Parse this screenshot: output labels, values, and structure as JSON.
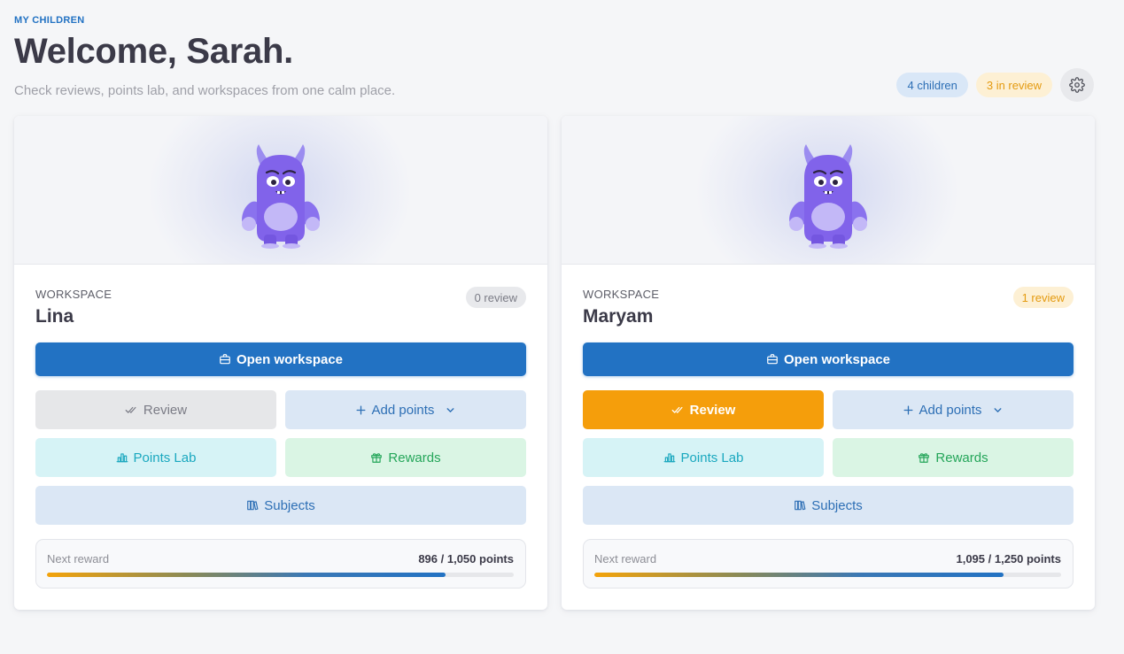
{
  "header": {
    "eyebrow": "MY CHILDREN",
    "title": "Welcome, Sarah.",
    "subtitle": "Check reviews, points lab, and workspaces from one calm place.",
    "children_chip": "4 children",
    "review_chip": "3 in review",
    "settings_icon": "gear-icon"
  },
  "colors": {
    "primary": "#2272c3",
    "review_active": "#f59e0b",
    "points_lab": "#1aa8bf",
    "rewards": "#25a65a"
  },
  "cards": [
    {
      "section_label": "WORKSPACE",
      "name": "Lina",
      "review_badge": "0 review",
      "open_label": "Open workspace",
      "review_label": "Review",
      "review_state": "disabled",
      "add_points_label": "Add points",
      "points_lab_label": "Points Lab",
      "rewards_label": "Rewards",
      "subjects_label": "Subjects",
      "next_reward_label": "Next reward",
      "progress_text": "896 / 1,050 points",
      "progress_current": 896,
      "progress_target": 1050
    },
    {
      "section_label": "WORKSPACE",
      "name": "Maryam",
      "review_badge": "1 review",
      "open_label": "Open workspace",
      "review_label": "Review",
      "review_state": "active",
      "add_points_label": "Add points",
      "points_lab_label": "Points Lab",
      "rewards_label": "Rewards",
      "subjects_label": "Subjects",
      "next_reward_label": "Next reward",
      "progress_text": "1,095 / 1,250 points",
      "progress_current": 1095,
      "progress_target": 1250
    }
  ]
}
